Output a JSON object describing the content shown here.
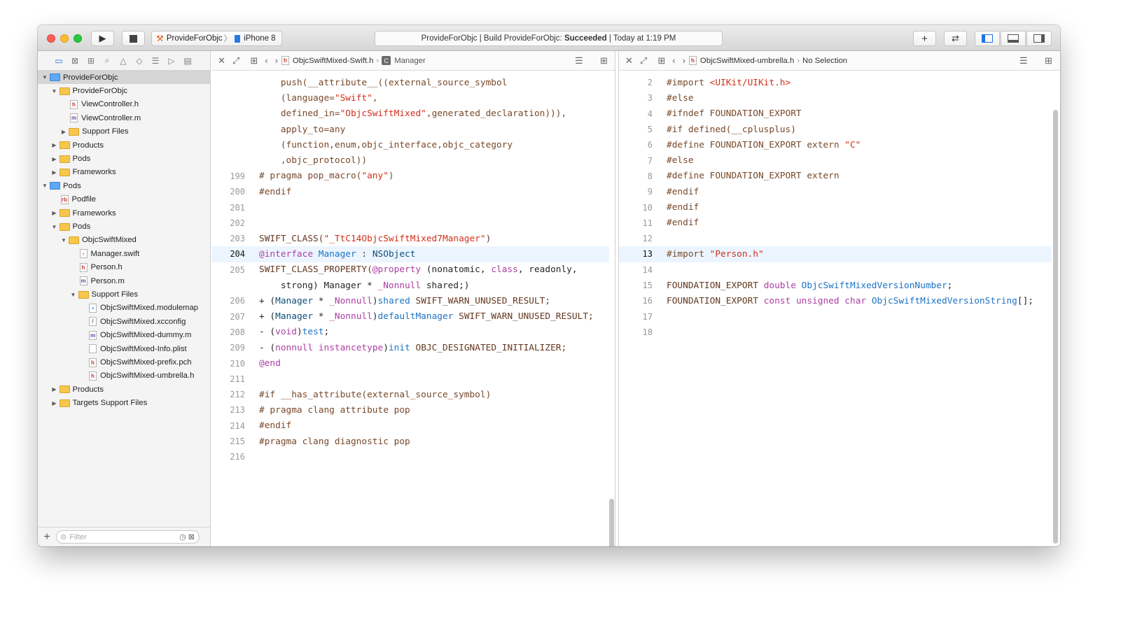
{
  "toolbar": {
    "scheme_name": "ProvideForObjc",
    "scheme_separator": "〉",
    "device_name": "iPhone 8",
    "activity_prefix": "ProvideForObjc | Build ProvideForObjc: ",
    "activity_status": "Succeeded",
    "activity_suffix": " | Today at 1:19 PM"
  },
  "navigator": {
    "items": [
      {
        "label": "ProvideForObjc",
        "depth": 0,
        "kind": "project",
        "expanded": true,
        "selected": true
      },
      {
        "label": "ProvideForObjc",
        "depth": 1,
        "kind": "folder",
        "expanded": true
      },
      {
        "label": "ViewController.h",
        "depth": 2,
        "kind": "h"
      },
      {
        "label": "ViewController.m",
        "depth": 2,
        "kind": "m"
      },
      {
        "label": "Support Files",
        "depth": 2,
        "kind": "folder",
        "expanded": false
      },
      {
        "label": "Products",
        "depth": 1,
        "kind": "folder",
        "expanded": false
      },
      {
        "label": "Pods",
        "depth": 1,
        "kind": "folder",
        "expanded": false
      },
      {
        "label": "Frameworks",
        "depth": 1,
        "kind": "folder",
        "expanded": false
      },
      {
        "label": "Pods",
        "depth": 0,
        "kind": "project",
        "expanded": true
      },
      {
        "label": "Podfile",
        "depth": 1,
        "kind": "rb"
      },
      {
        "label": "Frameworks",
        "depth": 1,
        "kind": "folder",
        "expanded": false
      },
      {
        "label": "Pods",
        "depth": 1,
        "kind": "folder",
        "expanded": true
      },
      {
        "label": "ObjcSwiftMixed",
        "depth": 2,
        "kind": "folder",
        "expanded": true
      },
      {
        "label": "Manager.swift",
        "depth": 3,
        "kind": "swift"
      },
      {
        "label": "Person.h",
        "depth": 3,
        "kind": "h"
      },
      {
        "label": "Person.m",
        "depth": 3,
        "kind": "m"
      },
      {
        "label": "Support Files",
        "depth": 3,
        "kind": "folder",
        "expanded": true
      },
      {
        "label": "ObjcSwiftMixed.modulemap",
        "depth": 4,
        "kind": "map"
      },
      {
        "label": "ObjcSwiftMixed.xcconfig",
        "depth": 4,
        "kind": "cfg"
      },
      {
        "label": "ObjcSwiftMixed-dummy.m",
        "depth": 4,
        "kind": "m"
      },
      {
        "label": "ObjcSwiftMixed-Info.plist",
        "depth": 4,
        "kind": "plist"
      },
      {
        "label": "ObjcSwiftMixed-prefix.pch",
        "depth": 4,
        "kind": "h"
      },
      {
        "label": "ObjcSwiftMixed-umbrella.h",
        "depth": 4,
        "kind": "h"
      },
      {
        "label": "Products",
        "depth": 1,
        "kind": "folder",
        "expanded": false
      },
      {
        "label": "Targets Support Files",
        "depth": 1,
        "kind": "folder",
        "expanded": false
      }
    ],
    "filter_placeholder": "Filter"
  },
  "left_editor": {
    "file_name": "ObjcSwiftMixed-Swift.h",
    "symbol_name": "Manager",
    "lines": [
      {
        "num": "",
        "tokens": [
          [
            "    push(__attribute__((external_source_symbol",
            "p"
          ]
        ]
      },
      {
        "num": "",
        "tokens": [
          [
            "    (language=",
            "p"
          ],
          [
            "\"Swift\"",
            "s"
          ],
          [
            ",",
            "p"
          ]
        ]
      },
      {
        "num": "",
        "tokens": [
          [
            "    defined_in=",
            "p"
          ],
          [
            "\"ObjcSwiftMixed\"",
            "s"
          ],
          [
            ",generated_declaration))),",
            "p"
          ]
        ]
      },
      {
        "num": "",
        "tokens": [
          [
            "    apply_to=any",
            "p"
          ]
        ]
      },
      {
        "num": "",
        "tokens": [
          [
            "    (function,enum,objc_interface,objc_category",
            "p"
          ]
        ]
      },
      {
        "num": "",
        "tokens": [
          [
            "    ,objc_protocol))",
            "p"
          ]
        ]
      },
      {
        "num": "199",
        "tokens": [
          [
            "# pragma pop_macro(",
            "p"
          ],
          [
            "\"any\"",
            "s"
          ],
          [
            ")",
            "p"
          ]
        ]
      },
      {
        "num": "200",
        "tokens": [
          [
            "#endif",
            "p"
          ]
        ]
      },
      {
        "num": "201",
        "tokens": []
      },
      {
        "num": "202",
        "tokens": []
      },
      {
        "num": "203",
        "tokens": [
          [
            "SWIFT_CLASS(",
            "m"
          ],
          [
            "\"_TtC14ObjcSwiftMixed7Manager\"",
            "s"
          ],
          [
            ")",
            "m"
          ]
        ]
      },
      {
        "num": "204",
        "current": true,
        "tokens": [
          [
            "@interface",
            "k"
          ],
          [
            " ",
            "x"
          ],
          [
            "Manager",
            "b"
          ],
          [
            " : ",
            "x"
          ],
          [
            "NSObject",
            "t"
          ]
        ]
      },
      {
        "num": "205",
        "tokens": [
          [
            "SWIFT_CLASS_PROPERTY(",
            "m"
          ],
          [
            "@property",
            "k"
          ],
          [
            " (nonatomic, ",
            "x"
          ],
          [
            "class",
            "k"
          ],
          [
            ", readonly,",
            "x"
          ]
        ]
      },
      {
        "num": "",
        "tokens": [
          [
            "    strong) Manager * ",
            "x"
          ],
          [
            "_Nonnull",
            "k"
          ],
          [
            " shared;)",
            "x"
          ]
        ]
      },
      {
        "num": "206",
        "tokens": [
          [
            "+ (",
            "x"
          ],
          [
            "Manager",
            "t"
          ],
          [
            " * ",
            "x"
          ],
          [
            "_Nonnull",
            "k"
          ],
          [
            ")",
            "x"
          ],
          [
            "shared",
            "b"
          ],
          [
            " SWIFT_WARN_UNUSED_RESULT;",
            "m"
          ]
        ]
      },
      {
        "num": "207",
        "tokens": [
          [
            "+ (",
            "x"
          ],
          [
            "Manager",
            "t"
          ],
          [
            " * ",
            "x"
          ],
          [
            "_Nonnull",
            "k"
          ],
          [
            ")",
            "x"
          ],
          [
            "defaultManager",
            "b"
          ],
          [
            " SWIFT_WARN_UNUSED_RESULT;",
            "m"
          ]
        ]
      },
      {
        "num": "208",
        "tokens": [
          [
            "- (",
            "x"
          ],
          [
            "void",
            "k"
          ],
          [
            ")",
            "x"
          ],
          [
            "test",
            "b"
          ],
          [
            ";",
            "x"
          ]
        ]
      },
      {
        "num": "209",
        "tokens": [
          [
            "- (",
            "x"
          ],
          [
            "nonnull",
            "k"
          ],
          [
            " ",
            "x"
          ],
          [
            "instancetype",
            "k"
          ],
          [
            ")",
            "x"
          ],
          [
            "init",
            "b"
          ],
          [
            " OBJC_DESIGNATED_INITIALIZER;",
            "m"
          ]
        ]
      },
      {
        "num": "210",
        "tokens": [
          [
            "@end",
            "k"
          ]
        ]
      },
      {
        "num": "211",
        "tokens": []
      },
      {
        "num": "212",
        "tokens": [
          [
            "#if __has_attribute(external_source_symbol)",
            "p"
          ]
        ]
      },
      {
        "num": "213",
        "tokens": [
          [
            "# pragma clang attribute pop",
            "p"
          ]
        ]
      },
      {
        "num": "214",
        "tokens": [
          [
            "#endif",
            "p"
          ]
        ]
      },
      {
        "num": "215",
        "tokens": [
          [
            "#pragma clang diagnostic pop",
            "p"
          ]
        ]
      },
      {
        "num": "216",
        "tokens": []
      }
    ]
  },
  "right_editor": {
    "file_name": "ObjcSwiftMixed-umbrella.h",
    "selection_label": "No Selection",
    "lines": [
      {
        "num": "2",
        "tokens": [
          [
            "#import ",
            "p"
          ],
          [
            "<UIKit/UIKit.h>",
            "s"
          ]
        ]
      },
      {
        "num": "3",
        "tokens": [
          [
            "#else",
            "p"
          ]
        ]
      },
      {
        "num": "4",
        "tokens": [
          [
            "#ifndef FOUNDATION_EXPORT",
            "p"
          ]
        ]
      },
      {
        "num": "5",
        "tokens": [
          [
            "#if defined(__cplusplus)",
            "p"
          ]
        ]
      },
      {
        "num": "6",
        "tokens": [
          [
            "#define FOUNDATION_EXPORT extern ",
            "p"
          ],
          [
            "\"C\"",
            "s"
          ]
        ]
      },
      {
        "num": "7",
        "tokens": [
          [
            "#else",
            "p"
          ]
        ]
      },
      {
        "num": "8",
        "tokens": [
          [
            "#define FOUNDATION_EXPORT extern",
            "p"
          ]
        ]
      },
      {
        "num": "9",
        "tokens": [
          [
            "#endif",
            "p"
          ]
        ]
      },
      {
        "num": "10",
        "tokens": [
          [
            "#endif",
            "p"
          ]
        ]
      },
      {
        "num": "11",
        "tokens": [
          [
            "#endif",
            "p"
          ]
        ]
      },
      {
        "num": "12",
        "tokens": []
      },
      {
        "num": "13",
        "current": true,
        "tokens": [
          [
            "#import ",
            "p"
          ],
          [
            "\"Person.h\"",
            "s"
          ]
        ]
      },
      {
        "num": "14",
        "tokens": []
      },
      {
        "num": "15",
        "tokens": [
          [
            "FOUNDATION_EXPORT ",
            "m"
          ],
          [
            "double",
            "k"
          ],
          [
            " ",
            "x"
          ],
          [
            "ObjcSwiftMixedVersionNumber",
            "b"
          ],
          [
            ";",
            "x"
          ]
        ]
      },
      {
        "num": "16",
        "tokens": [
          [
            "FOUNDATION_EXPORT ",
            "m"
          ],
          [
            "const",
            "k"
          ],
          [
            " ",
            "x"
          ],
          [
            "unsigned",
            "k"
          ],
          [
            " ",
            "x"
          ],
          [
            "char",
            "k"
          ],
          [
            " ",
            "x"
          ],
          [
            "ObjcSwiftMixedVersionString",
            "b"
          ],
          [
            "[];",
            "x"
          ]
        ]
      },
      {
        "num": "17",
        "tokens": []
      },
      {
        "num": "18",
        "tokens": []
      }
    ]
  }
}
